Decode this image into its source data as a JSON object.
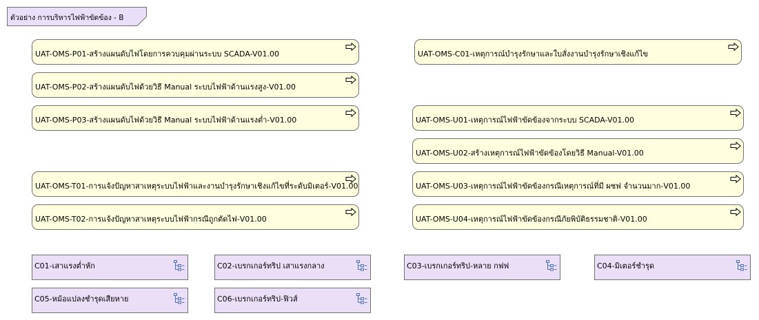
{
  "header": {
    "title": "ตัวอย่าง การบริหารไฟฟ้าขัดข้อง - B"
  },
  "processes": {
    "p01": "UAT-OMS-P01-สร้างแผนดับไฟโดยการควบคุมผ่านระบบ SCADA-V01.00",
    "p02": "UAT-OMS-P02-สร้างแผนดับไฟด้วยวิธี Manual ระบบไฟฟ้าด้านแรงสูง-V01.00",
    "p03": "UAT-OMS-P03-สร้างแผนดับไฟด้วยวิธี Manual ระบบไฟฟ้าด้านแรงต่ำ-V01.00",
    "t01": "UAT-OMS-T01-การแจ้งปัญหาสาเหตุระบบไฟฟ้าและงานบำรุงรักษาเชิงแก้ไขที่ระดับมิเตอร์-V01.00",
    "t02": "UAT-OMS-T02-การแจ้งปัญหาสาเหตุระบบไฟฟ้ากรณีถูกตัดไฟ-V01.00",
    "c01": "UAT-OMS-C01-เหตุการณ์บำรุงรักษาและใบสั่งงานบำรุงรักษาเชิงแก้ไข",
    "u01": "UAT-OMS-U01-เหตุการณ์ไฟฟ้าขัดข้องจากระบบ SCADA-V01.00",
    "u02": "UAT-OMS-U02-สร้างเหตุการณ์ไฟฟ้าขัดข้องโดยวิธี Manual-V01.00",
    "u03": "UAT-OMS-U03-เหตุการณ์ไฟฟ้าขัดข้องกรณีเหตุการณ์ที่มี ผชฟ จำนวนมาก-V01.00",
    "u04": "UAT-OMS-U04-เหตุการณ์ไฟฟ้าขัดข้องกรณีภัยพิบัติธรรมชาติ-V01.00"
  },
  "functions": {
    "c01": "C01-เสาแรงต่ำหัก",
    "c02": "C02-เบรกเกอร์ทริป เสาแรงกลาง",
    "c03": "C03-เบรกเกอร์ทริป-หลาย กฟฟ",
    "c04": "C04-มิเตอร์ชำรุด",
    "c05": "C05-หม้อแปลงชำรุดเสียหาย",
    "c06": "C06-เบรกเกอร์ทริป-ฟิวส์"
  },
  "icons": {
    "process_link": "process-interface-arrow-icon",
    "function_tree": "function-tree-icon",
    "grouping": "grouping-tab-icon"
  },
  "colors": {
    "process_fill": "#ffffe0",
    "function_fill": "#ebdff8",
    "grouping_fill": "#e9dff9",
    "border": "#707070"
  }
}
